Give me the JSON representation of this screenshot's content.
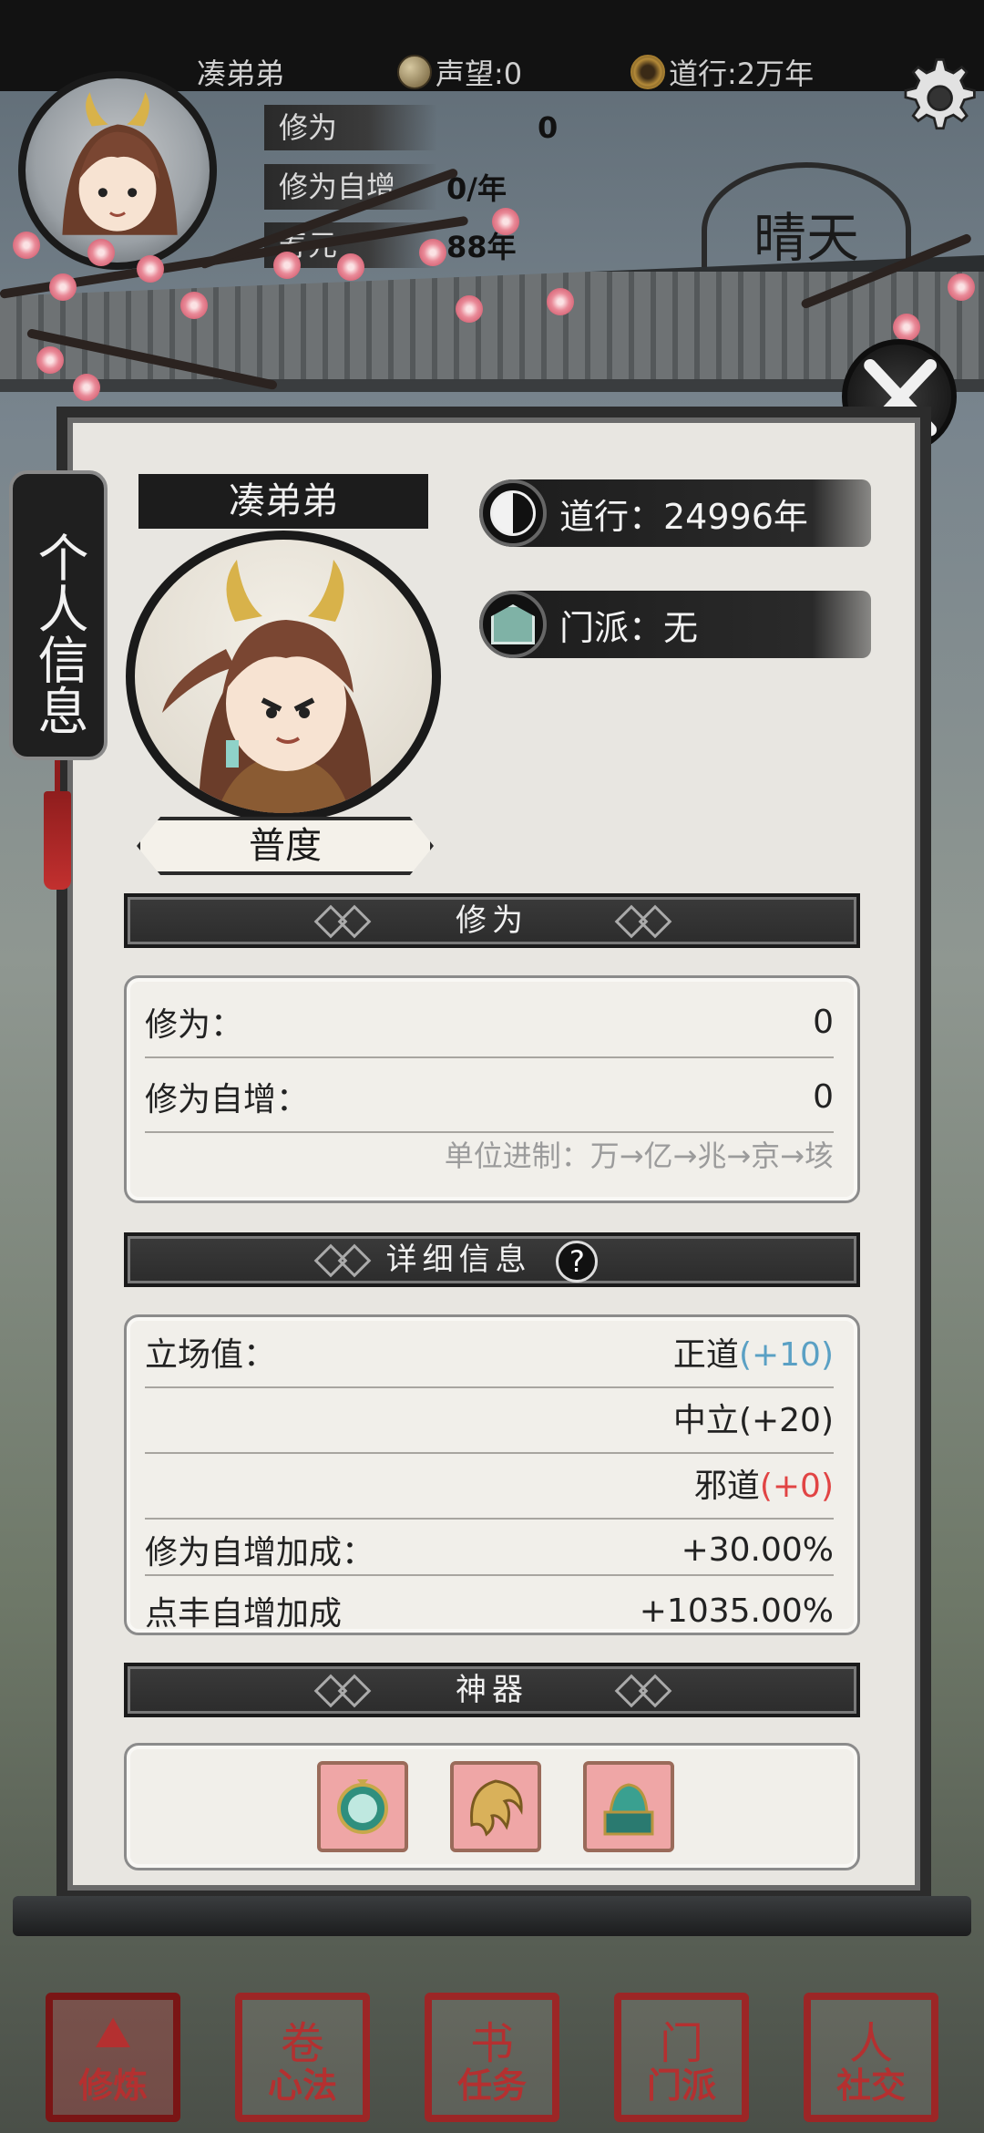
{
  "top_bar": {
    "player_name": "凑弟弟",
    "fame_text": "声望:0",
    "dao_text": "道行:2万年"
  },
  "header_stats": [
    {
      "label": "修为",
      "value": "0"
    },
    {
      "label": "修为自增",
      "value": "0/年"
    },
    {
      "label": "寿元",
      "value": "88年"
    }
  ],
  "weather": "晴天",
  "panel": {
    "side_tab": "个人信息",
    "name": "凑弟弟",
    "rank": "普度",
    "dao_line": "道行：24996年",
    "sect_line": "门派：无"
  },
  "cultivation": {
    "title": "修为",
    "rows": [
      {
        "label": "修为：",
        "value": "0"
      },
      {
        "label": "修为自增：",
        "value": "0"
      }
    ],
    "unit_note": "单位进制：万→亿→兆→京→垓"
  },
  "details": {
    "title": "详细信息",
    "help": "?",
    "stance_label": "立场值：",
    "stance": [
      {
        "name": "正道",
        "bonus": "(+10)"
      },
      {
        "name": "中立",
        "bonus": "(+20)"
      },
      {
        "name": "邪道",
        "bonus": "(+0)"
      }
    ],
    "growth_label": "修为自增加成：",
    "growth_value": "+30.00%",
    "partial_label": "点丰自增加成",
    "partial_value": "+1035.00%"
  },
  "artifacts": {
    "title": "神器",
    "items": [
      "mirror-relic-icon",
      "claw-relic-icon",
      "seal-relic-icon"
    ]
  },
  "nav": [
    {
      "glyph": "⛰",
      "label": "修炼"
    },
    {
      "glyph": "卷",
      "label": "心法"
    },
    {
      "glyph": "书",
      "label": "任务"
    },
    {
      "glyph": "门",
      "label": "门派"
    },
    {
      "glyph": "人",
      "label": "社交"
    }
  ],
  "colors": {
    "accent_red": "#b43030",
    "positive_blue": "#5aa0c4",
    "negative_red": "#e14444"
  }
}
